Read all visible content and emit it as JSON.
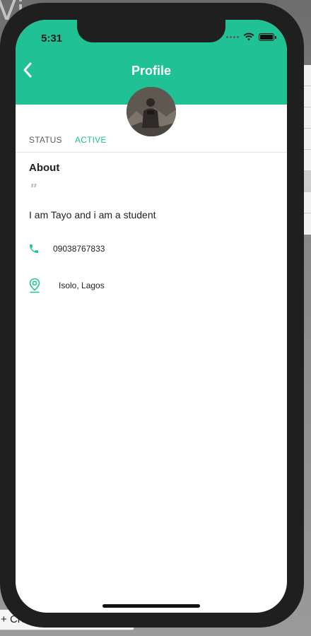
{
  "status_bar": {
    "time": "5:31"
  },
  "header": {
    "title": "Profile"
  },
  "tabs": [
    {
      "label": "STATUS"
    },
    {
      "label": "ACTIVE"
    }
  ],
  "about": {
    "heading": "About",
    "quote_mark": "\"",
    "bio": "I am Tayo and i am a student"
  },
  "contact": {
    "phone": "09038767833",
    "location": "Isolo, Lagos"
  },
  "icons": {
    "back": "chevron-left-icon",
    "phone": "phone-icon",
    "location": "location-pin-icon"
  },
  "colors": {
    "accent": "#20c295",
    "header_text": "#ffffff"
  },
  "background": {
    "button_label": "Crea"
  }
}
